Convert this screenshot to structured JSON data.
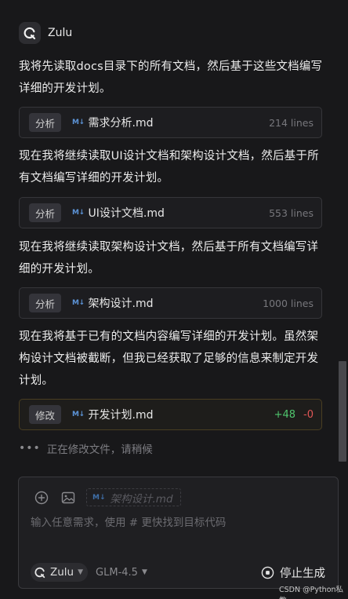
{
  "header": {
    "agent_name": "Zulu",
    "logo_icon": "zulu-logo-icon"
  },
  "messages": [
    "我将先读取docs目录下的所有文档，然后基于这些文档编写详细的开发计划。",
    "现在我将继续读取UI设计文档和架构设计文档，然后基于所有文档编写详细的开发计划。",
    "现在我将继续读取架构设计文档，然后基于所有文档编写详细的开发计划。",
    "现在我将基于已有的文档内容编写详细的开发计划。虽然架构设计文档被截断，但我已经获取了足够的信息来制定开发计划。"
  ],
  "file_cards": [
    {
      "tag": "分析",
      "icon_text": "M↓",
      "name": "需求分析.md",
      "lines": "214 lines"
    },
    {
      "tag": "分析",
      "icon_text": "M↓",
      "name": "UI设计文档.md",
      "lines": "553 lines"
    },
    {
      "tag": "分析",
      "icon_text": "M↓",
      "name": "架构设计.md",
      "lines": "1000 lines"
    }
  ],
  "edit_card": {
    "tag": "修改",
    "icon_text": "M↓",
    "name": "开发计划.md",
    "added": "+48",
    "removed": "-0"
  },
  "status": {
    "dots": "•••",
    "text": "正在修改文件，请稍候"
  },
  "composer": {
    "context_chip": {
      "icon_text": "M↓",
      "name": "架构设计.md"
    },
    "placeholder": "输入任意需求，使用 # 更快找到目标代码",
    "agent_select": "Zulu",
    "model_select": "GLM-4.5",
    "stop_label": "停止生成"
  },
  "watermark": "CSDN @Python私教",
  "colors": {
    "background": "#18181a",
    "card_border": "#36363a",
    "edit_border": "#4a3e22",
    "md_icon": "#5c93d6",
    "added": "#4fc56d",
    "removed": "#e15656"
  }
}
